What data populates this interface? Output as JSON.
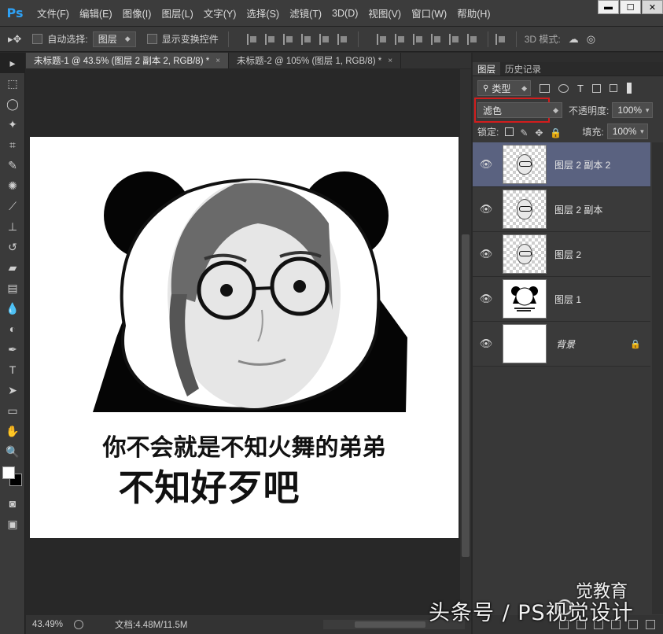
{
  "app": {
    "logo": "Ps"
  },
  "menu": [
    "文件(F)",
    "编辑(E)",
    "图像(I)",
    "图层(L)",
    "文字(Y)",
    "选择(S)",
    "滤镜(T)",
    "3D(D)",
    "视图(V)",
    "窗口(W)",
    "帮助(H)"
  ],
  "window_controls": {
    "minimize": "▬",
    "maximize": "☐",
    "close": "✕"
  },
  "options": {
    "auto_select_label": "自动选择:",
    "auto_select_value": "图层",
    "show_transform_label": "显示变换控件",
    "mode3d_label": "3D 模式:"
  },
  "tabs": [
    {
      "label": "未标题-1 @ 43.5% (图层 2 副本 2, RGB/8) *",
      "close": "×"
    },
    {
      "label": "未标题-2 @ 105% (图层 1, RGB/8) *",
      "close": "×"
    }
  ],
  "canvas": {
    "line1": "你不会就是不知火舞的弟弟",
    "line2": "不知好歹吧"
  },
  "status": {
    "zoom": "43.49%",
    "doc": "文档:4.48M/11.5M"
  },
  "panels": {
    "tab_layers": "图层",
    "tab_history": "历史记录",
    "filter_kind": "类型",
    "blend_mode": "滤色",
    "opacity_label": "不透明度:",
    "opacity_value": "100%",
    "lock_label": "锁定:",
    "fill_label": "填充:",
    "fill_value": "100%"
  },
  "layers": [
    {
      "name": "图层 2 副本 2",
      "selected": true
    },
    {
      "name": "图层 2 副本"
    },
    {
      "name": "图层 2"
    },
    {
      "name": "图层 1"
    },
    {
      "name": "背景",
      "locked": true
    }
  ],
  "watermark": "头条号 / PS视觉设计",
  "watermark_logo_text": "觉教育",
  "colors": {
    "accent_red": "#d21d1d",
    "selected_layer": "#5a6280",
    "ps_blue": "#2ea1f5"
  }
}
